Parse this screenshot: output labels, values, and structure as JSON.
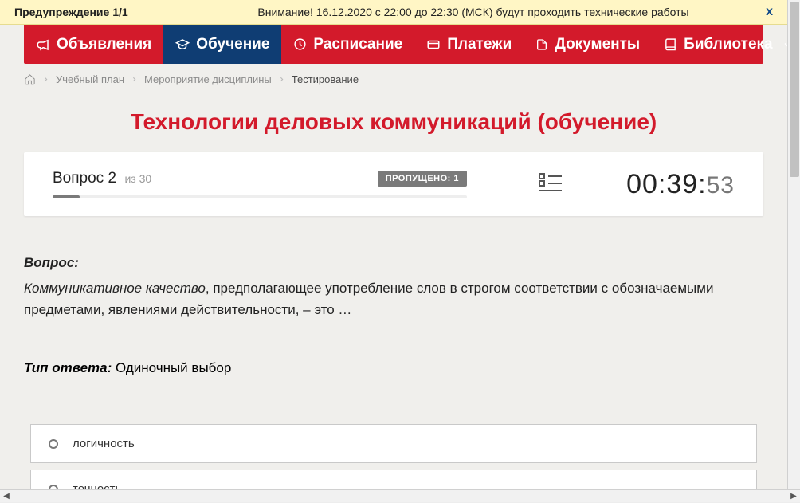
{
  "warning": {
    "title": "Предупреждение 1/1",
    "message": "Внимание! 16.12.2020 с 22:00 до 22:30 (МСК) будут проходить технические работы",
    "close": "x"
  },
  "nav": {
    "announcements": "Объявления",
    "learning": "Обучение",
    "schedule": "Расписание",
    "payments": "Платежи",
    "documents": "Документы",
    "library": "Библиотека"
  },
  "breadcrumbs": {
    "plan": "Учебный план",
    "event": "Мероприятие дисциплины",
    "current": "Тестирование"
  },
  "page_title": "Технологии деловых коммуникаций (обучение)",
  "status": {
    "question_label": "Вопрос 2",
    "total_label": "из 30",
    "skipped": "ПРОПУЩЕНО: 1",
    "timer_main": "00:39:",
    "timer_sec": "53"
  },
  "question": {
    "prefix": "Вопрос:",
    "emphasis": "Коммуникативное качество",
    "rest": ", предполагающее употребление слов в строгом соответствии с обозначаемыми предметами, явлениями действительности, – это …"
  },
  "answer_type": {
    "label": "Тип ответа:",
    "value": " Одиночный выбор"
  },
  "options": [
    "логичность",
    "точность"
  ]
}
